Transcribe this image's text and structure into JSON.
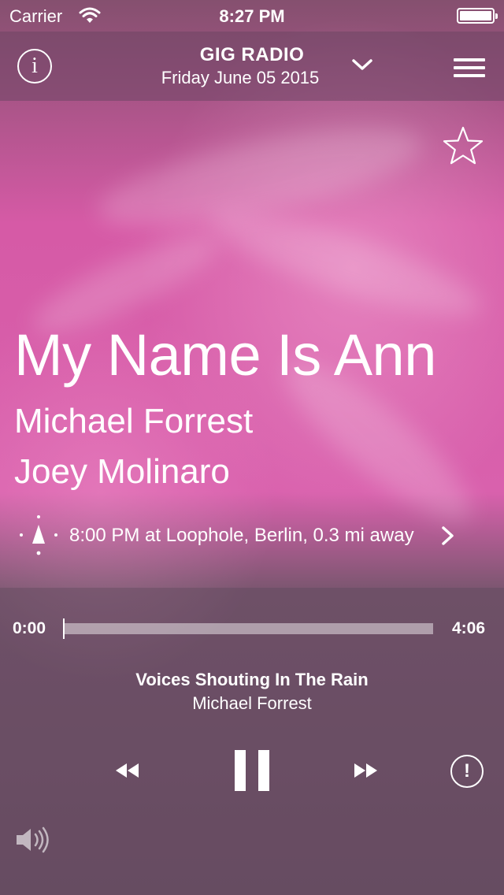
{
  "status_bar": {
    "carrier": "Carrier",
    "time": "8:27 PM"
  },
  "header": {
    "station": "GIG RADIO",
    "date": "Friday June 05 2015",
    "info_glyph": "i"
  },
  "track": {
    "title": "My Name Is Ann",
    "artists": [
      "Michael Forrest",
      "Joey Molinaro"
    ],
    "gig": "8:00 PM at Loophole, Berlin, 0.3 mi away"
  },
  "player": {
    "elapsed": "0:00",
    "duration": "4:06",
    "progress_fraction": 0.0,
    "now_playing_title": "Voices Shouting In The Rain",
    "now_playing_artist": "Michael Forrest",
    "report_glyph": "!"
  },
  "icons": [
    "wifi-icon",
    "battery-icon",
    "info-icon",
    "chevron-down-icon",
    "menu-icon",
    "star-icon",
    "compass-icon",
    "chevron-right-icon",
    "rewind-icon",
    "pause-icon",
    "fast-forward-icon",
    "report-icon",
    "volume-icon"
  ]
}
